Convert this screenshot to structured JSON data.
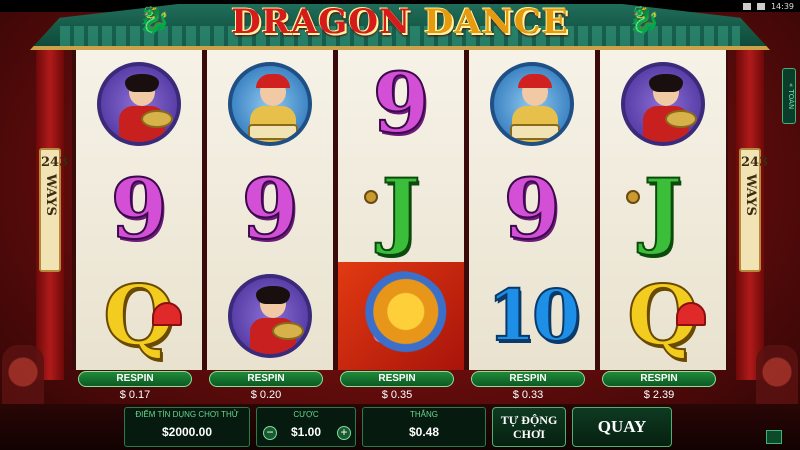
{
  "status": {
    "time": "14:39"
  },
  "title": {
    "word1": "DRAGON",
    "word2": "DANCE"
  },
  "ways_label": [
    "243",
    "WAYS"
  ],
  "toan_label": "« TOÀN",
  "reels": [
    [
      "woman-cymbal-icon",
      "nine",
      "queen"
    ],
    [
      "drummer-icon",
      "nine",
      "woman-cymbal-icon"
    ],
    [
      "nine",
      "jack",
      "dragon-icon"
    ],
    [
      "drummer-icon",
      "nine",
      "ten"
    ],
    [
      "woman-cymbal-icon",
      "jack",
      "queen"
    ]
  ],
  "symbols": {
    "nine": "9",
    "jack": "J",
    "queen": "Q",
    "ten": "10"
  },
  "respin": {
    "label": "RESPIN",
    "costs": [
      "$ 0.17",
      "$ 0.20",
      "$ 0.35",
      "$ 0.33",
      "$ 2.39"
    ]
  },
  "bottom": {
    "credit_label": "ĐIỂM TÍN DỤNG CHƠI THỬ",
    "credit_value": "$2000.00",
    "bet_label": "CƯỢC",
    "bet_value": "$1.00",
    "bet_minus": "−",
    "bet_plus": "+",
    "win_label": "THẮNG",
    "win_value": "$0.48",
    "autoplay_line1": "TỰ ĐỘNG",
    "autoplay_line2": "CHƠI",
    "spin_label": "QUAY"
  },
  "colors": {
    "accent_green": "#1f8a3a",
    "roof": "#1f6e5a",
    "title_red": "#d61b1b"
  }
}
